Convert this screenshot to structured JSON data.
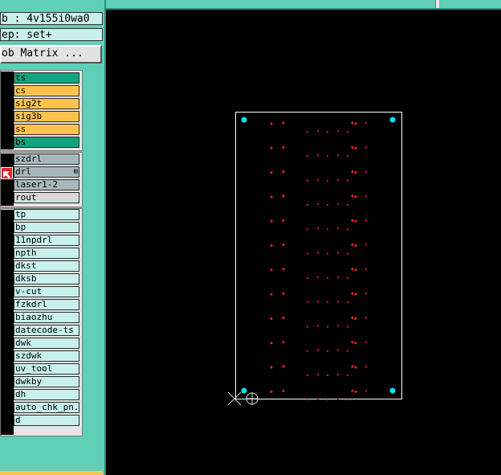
{
  "header": {
    "job_label": "b : 4v155i0wa0",
    "step_label": "ep: set+",
    "matrix_button": "ob Matrix ..."
  },
  "layers": {
    "group1": [
      {
        "label": "ts",
        "color": "green"
      },
      {
        "label": "cs",
        "color": "yellow"
      },
      {
        "label": "sig2t",
        "color": "yellow"
      },
      {
        "label": "sig3b",
        "color": "yellow"
      },
      {
        "label": "ss",
        "color": "yellow"
      },
      {
        "label": "bs",
        "color": "green"
      }
    ],
    "group2": [
      {
        "label": "szdrl",
        "color": "grey"
      },
      {
        "label": "drl",
        "color": "grey",
        "marker": "⊞"
      },
      {
        "label": "laser1-2",
        "color": "grey"
      },
      {
        "label": "rout",
        "color": "lgrey"
      }
    ],
    "group3": [
      {
        "label": "tp"
      },
      {
        "label": "bp"
      },
      {
        "label": "11npdrl"
      },
      {
        "label": "npth"
      },
      {
        "label": "dkst"
      },
      {
        "label": "dksb"
      },
      {
        "label": "v-cut"
      },
      {
        "label": "fzkdrl"
      },
      {
        "label": "biaozhu"
      },
      {
        "label": "datecode-ts"
      },
      {
        "label": "dwk"
      },
      {
        "label": "szdwk"
      },
      {
        "label": "uv_tool"
      },
      {
        "label": "dwkby"
      },
      {
        "label": "dh"
      },
      {
        "label": "auto_chk_pn."
      },
      {
        "label": "d"
      }
    ]
  },
  "colors": {
    "panel": "#5fcfb8",
    "canvas": "#000000",
    "board_outline": "#ffffff",
    "fiducial": "#00e5ff",
    "drill_hit": "#e02020",
    "active_layer": "#13a37e",
    "affected_layer": "#ffc34d"
  },
  "icons": {
    "work_layer_arrow": "red-arrow-icon",
    "origin": "crosshair-origin-icon"
  }
}
